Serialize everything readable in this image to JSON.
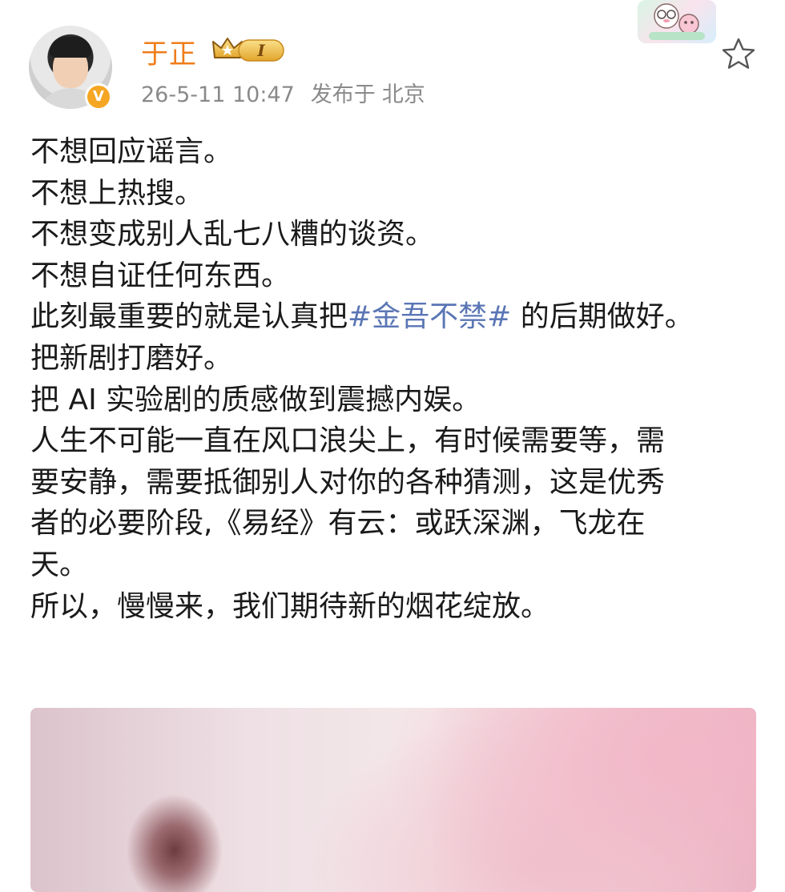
{
  "post": {
    "author": {
      "name": "于正",
      "vip_level": "I",
      "avatar": "avatar-photo"
    },
    "timestamp": "26-5-11 10:47",
    "location_prefix": "发布于",
    "location": "北京",
    "lines": [
      {
        "text": "不想回应谣言。"
      },
      {
        "text": "不想上热搜。"
      },
      {
        "text": "不想变成别人乱七八糟的谈资。"
      },
      {
        "text": "不想自证任何东西。"
      },
      {
        "before": "此刻最重要的就是认真把",
        "hashtag": "#金吾不禁#",
        "after": " 的后期做好。"
      },
      {
        "text": "把新剧打磨好。"
      },
      {
        "text": "把 AI 实验剧的质感做到震撼内娱。"
      },
      {
        "text": "人生不可能一直在风口浪尖上，有时候需要等，需"
      },
      {
        "text": "要安静，需要抵御别人对你的各种猜测，这是优秀"
      },
      {
        "text": "者的必要阶段,《易经》有云：或跃深渊，飞龙在"
      },
      {
        "text": "天。"
      },
      {
        "text": "所以，慢慢来，我们期待新的烟花绽放。"
      }
    ]
  },
  "icons": {
    "star": "star-outline-icon",
    "verified": "verified-v-icon",
    "vip": "crown-vip-icon"
  },
  "colors": {
    "username": "#ef7d1a",
    "meta": "#8a8a8a",
    "hashtag": "#5a76b5",
    "verified": "#f5a623",
    "body_text": "#1a1a1a"
  }
}
